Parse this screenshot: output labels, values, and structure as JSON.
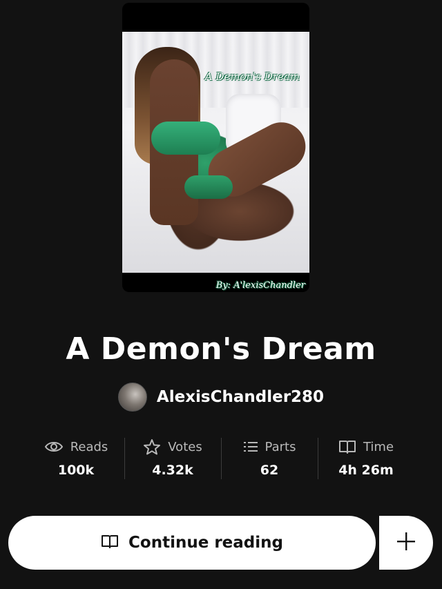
{
  "cover": {
    "title_text": "A Demon's Dream",
    "byline_text": "By: A'lexisChandler"
  },
  "story": {
    "title": "A Demon's Dream"
  },
  "author": {
    "name": "AlexisChandler280"
  },
  "stats": [
    {
      "icon": "eye-icon",
      "label": "Reads",
      "value": "100k"
    },
    {
      "icon": "star-icon",
      "label": "Votes",
      "value": "4.32k"
    },
    {
      "icon": "list-icon",
      "label": "Parts",
      "value": "62"
    },
    {
      "icon": "book-icon",
      "label": "Time",
      "value": "4h 26m"
    }
  ],
  "actions": {
    "continue_label": "Continue reading",
    "add_icon": "plus-icon"
  },
  "colors": {
    "background": "#121212",
    "button": "#ffffff",
    "muted_text": "#b9b9b9"
  }
}
